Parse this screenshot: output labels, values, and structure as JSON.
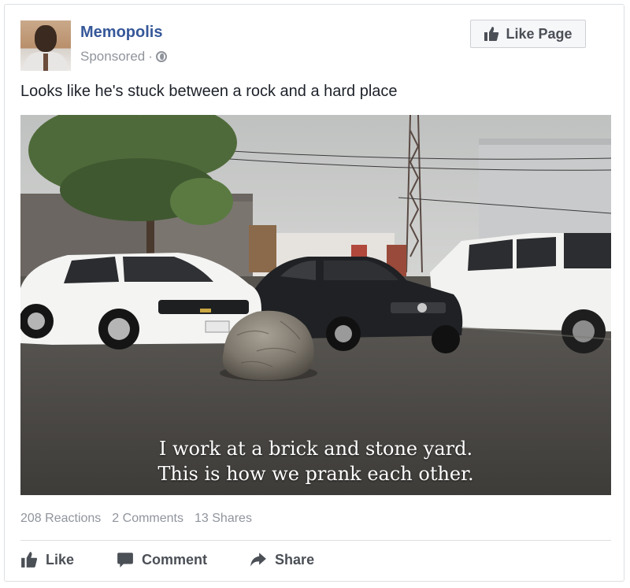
{
  "post": {
    "page_name": "Memopolis",
    "sponsored_label": "Sponsored",
    "separator": "·",
    "globe_icon": "globe-icon",
    "like_page_label": "Like Page",
    "caption": "Looks like he's stuck between a rock and a hard place",
    "image": {
      "overlay_line1": "I work at a brick and stone yard.",
      "overlay_line2": "This is how we prank each other."
    },
    "stats": {
      "reactions": "208 Reactions",
      "comments": "2 Comments",
      "shares": "13 Shares"
    },
    "actions": {
      "like": "Like",
      "comment": "Comment",
      "share": "Share"
    }
  },
  "colors": {
    "link_blue": "#365899",
    "muted_gray": "#90949c",
    "text_dark": "#1d2129",
    "button_text": "#4b4f56"
  }
}
